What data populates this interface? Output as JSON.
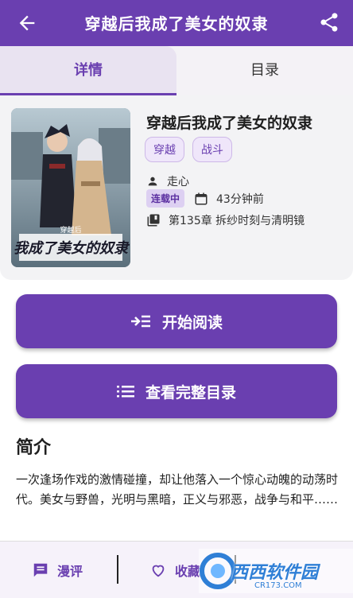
{
  "appbar": {
    "title": "穿越后我成了美女的奴隶"
  },
  "tabs": {
    "details": "详情",
    "catalog": "目录"
  },
  "book": {
    "title": "穿越后我成了美女的奴隶",
    "tags": [
      "穿越",
      "战斗"
    ],
    "author": "走心",
    "status": "连载中",
    "updated": "43分钟前",
    "latest_chapter": "第135章 拆纱时刻与清明镜",
    "cover_text": "我成了美女的奴隶",
    "cover_small": "穿越后"
  },
  "actions": {
    "start_reading": "开始阅读",
    "view_catalog": "查看完整目录"
  },
  "intro": {
    "heading": "简介",
    "text": "一次逢场作戏的激情碰撞，却让他落入一个惊心动魄的动荡时代。美女与野兽，光明与黑暗，正义与邪恶，战争与和平……"
  },
  "bottom": {
    "comments": "漫评",
    "favorite": "收藏"
  },
  "watermark": {
    "text": "西西软件园",
    "sub": "CR173.COM"
  },
  "colors": {
    "primary": "#6a3fb0",
    "tag_bg": "#efe6fa",
    "badge_bg": "#ddd0f2"
  }
}
